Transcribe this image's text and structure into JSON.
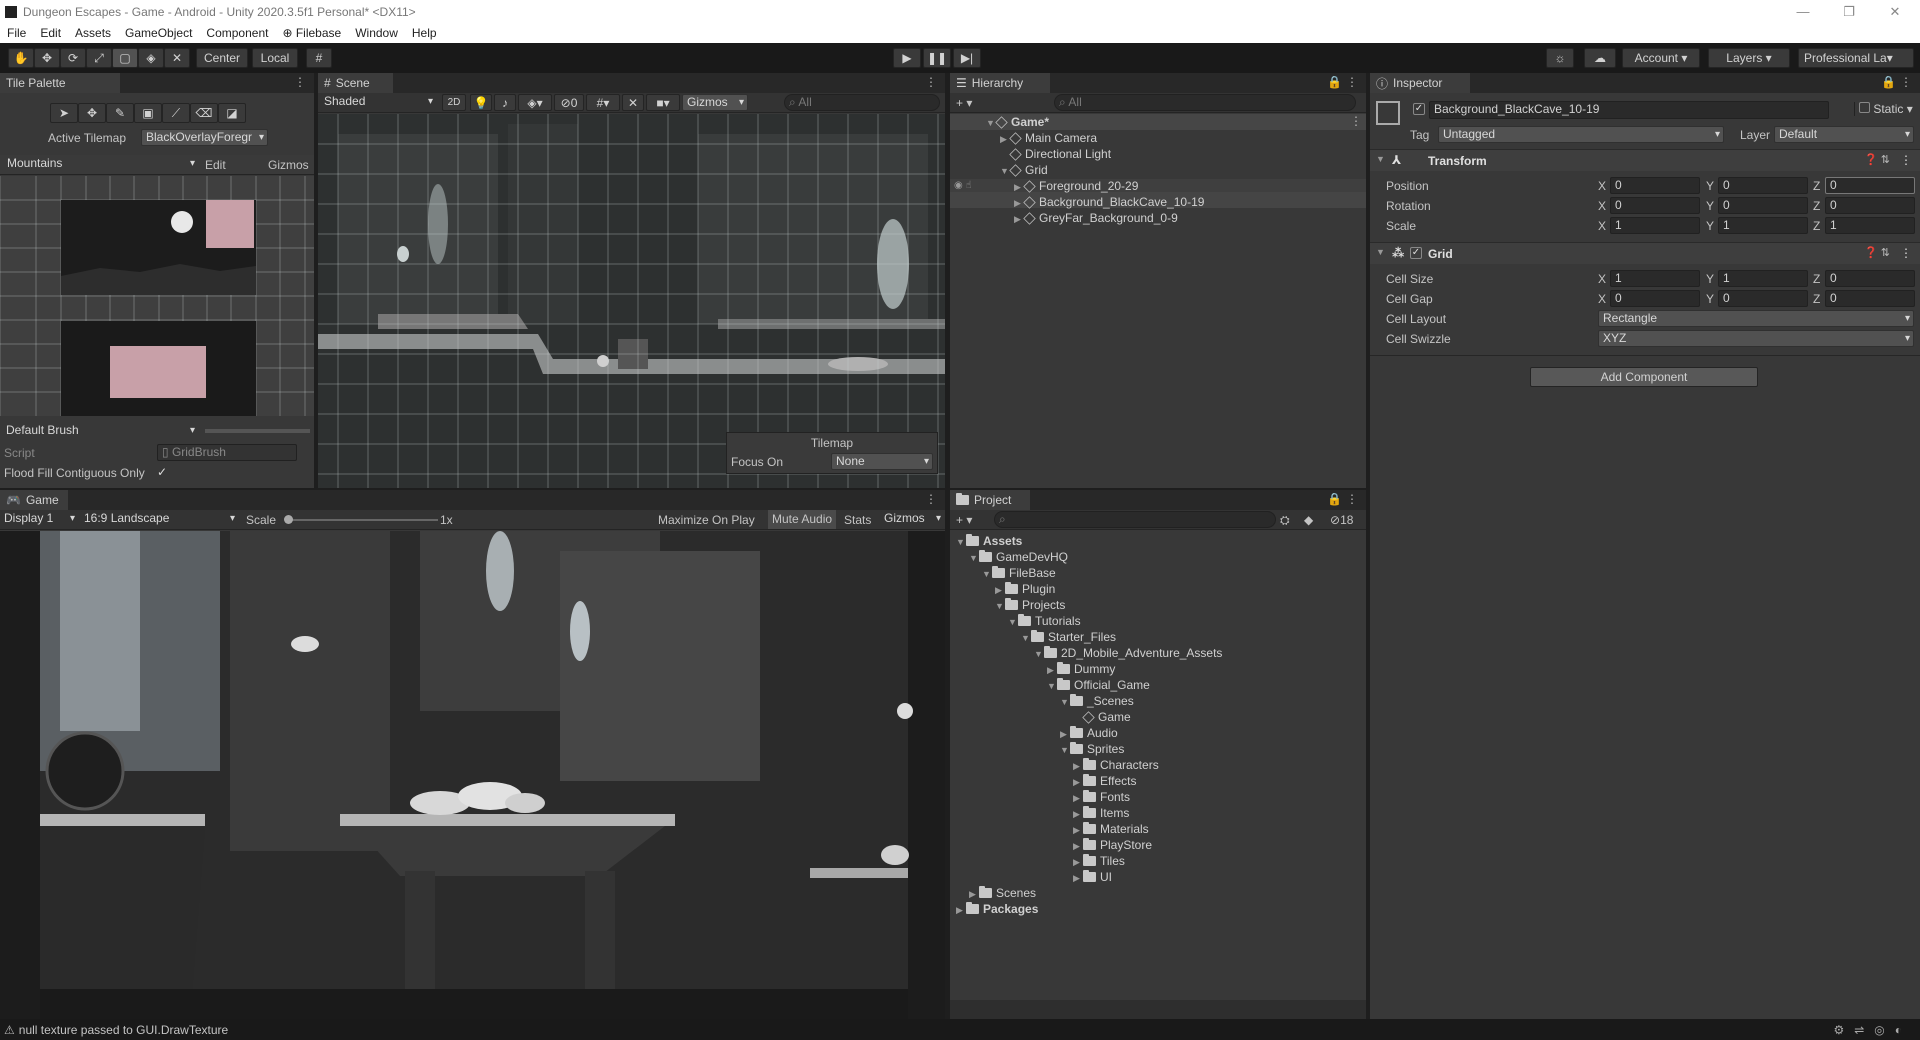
{
  "window": {
    "title": "Dungeon Escapes - Game - Android - Unity 2020.3.5f1 Personal* <DX11>"
  },
  "menu": [
    "File",
    "Edit",
    "Assets",
    "GameObject",
    "Component",
    "Filebase",
    "Window",
    "Help"
  ],
  "toolbar": {
    "center": "Center",
    "local": "Local",
    "account": "Account",
    "layers": "Layers",
    "layout": "Professional La"
  },
  "tile_palette": {
    "tab": "Tile Palette",
    "active_tilemap_label": "Active Tilemap",
    "active_tilemap_value": "BlackOverlayForegr",
    "palette": "Mountains",
    "edit": "Edit",
    "gizmos": "Gizmos",
    "brush": "Default Brush",
    "script_label": "Script",
    "script_value": "GridBrush",
    "flood_label": "Flood Fill Contiguous Only"
  },
  "scene": {
    "tab": "Scene",
    "shading": "Shaded",
    "mode2d": "2D",
    "hidden_count": "0",
    "gizmos": "Gizmos",
    "search_placeholder": "All",
    "tilemap_overlay": {
      "title": "Tilemap",
      "focus_label": "Focus On",
      "focus_value": "None"
    }
  },
  "hierarchy": {
    "tab": "Hierarchy",
    "search_placeholder": "All",
    "items": [
      {
        "label": "Game*",
        "depth": 0
      },
      {
        "label": "Main Camera",
        "depth": 1
      },
      {
        "label": "Directional Light",
        "depth": 1
      },
      {
        "label": "Grid",
        "depth": 1
      },
      {
        "label": "Foreground_20-29",
        "depth": 2
      },
      {
        "label": "Background_BlackCave_10-19",
        "depth": 2
      },
      {
        "label": "GreyFar_Background_0-9",
        "depth": 2
      }
    ]
  },
  "inspector": {
    "tab": "Inspector",
    "object_name": "Background_BlackCave_10-19",
    "static": "Static",
    "tag_label": "Tag",
    "tag_value": "Untagged",
    "layer_label": "Layer",
    "layer_value": "Default",
    "transform": {
      "title": "Transform",
      "rows": [
        {
          "label": "Position",
          "x": "0",
          "y": "0",
          "z": "0"
        },
        {
          "label": "Rotation",
          "x": "0",
          "y": "0",
          "z": "0"
        },
        {
          "label": "Scale",
          "x": "1",
          "y": "1",
          "z": "1"
        }
      ]
    },
    "grid": {
      "title": "Grid",
      "rows": [
        {
          "label": "Cell Size",
          "x": "1",
          "y": "1",
          "z": "0"
        },
        {
          "label": "Cell Gap",
          "x": "0",
          "y": "0",
          "z": "0"
        }
      ],
      "cell_layout_label": "Cell Layout",
      "cell_layout_value": "Rectangle",
      "cell_swizzle_label": "Cell Swizzle",
      "cell_swizzle_value": "XYZ"
    },
    "add_component": "Add Component",
    "axis": {
      "x": "X",
      "y": "Y",
      "z": "Z"
    }
  },
  "game": {
    "tab": "Game",
    "display": "Display 1",
    "aspect": "16:9 Landscape",
    "scale_label": "Scale",
    "scale_value": "1x",
    "maximize": "Maximize On Play",
    "mute": "Mute Audio",
    "stats": "Stats",
    "gizmos": "Gizmos"
  },
  "project": {
    "tab": "Project",
    "hidden_count": "18",
    "items": [
      {
        "label": "Assets",
        "depth": 0,
        "bold": true
      },
      {
        "label": "GameDevHQ",
        "depth": 1
      },
      {
        "label": "FileBase",
        "depth": 2
      },
      {
        "label": "Plugin",
        "depth": 3
      },
      {
        "label": "Projects",
        "depth": 3
      },
      {
        "label": "Tutorials",
        "depth": 4
      },
      {
        "label": "Starter_Files",
        "depth": 5
      },
      {
        "label": "2D_Mobile_Adventure_Assets",
        "depth": 6
      },
      {
        "label": "Dummy",
        "depth": 7
      },
      {
        "label": "Official_Game",
        "depth": 7
      },
      {
        "label": "_Scenes",
        "depth": 8
      },
      {
        "label": "Game",
        "depth": 9
      },
      {
        "label": "Audio",
        "depth": 8
      },
      {
        "label": "Sprites",
        "depth": 8
      },
      {
        "label": "Characters",
        "depth": 9
      },
      {
        "label": "Effects",
        "depth": 9
      },
      {
        "label": "Fonts",
        "depth": 9
      },
      {
        "label": "Items",
        "depth": 9
      },
      {
        "label": "Materials",
        "depth": 9
      },
      {
        "label": "PlayStore",
        "depth": 9
      },
      {
        "label": "Tiles",
        "depth": 9
      },
      {
        "label": "UI",
        "depth": 9
      },
      {
        "label": "Scenes",
        "depth": 1
      },
      {
        "label": "Packages",
        "depth": 0,
        "bold": true
      }
    ]
  },
  "status": {
    "message": "null texture passed to GUI.DrawTexture"
  }
}
